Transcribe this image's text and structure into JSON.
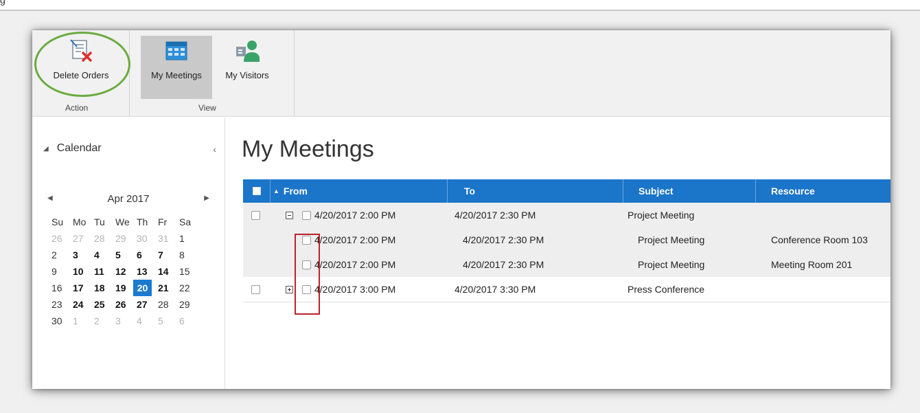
{
  "top_clip": "g",
  "ribbon": {
    "groups": [
      {
        "label": "Action"
      },
      {
        "label": "View"
      }
    ],
    "buttons": [
      {
        "label": "Delete Orders",
        "icon": "delete-orders-icon"
      },
      {
        "label": "My Meetings",
        "icon": "calendar-grid-icon"
      },
      {
        "label": "My Visitors",
        "icon": "visitors-icon"
      }
    ]
  },
  "calendar": {
    "header": "Calendar",
    "collapse": "‹",
    "month_title": "Apr 2017",
    "prev": "◀",
    "next": "▶",
    "dow": [
      "Su",
      "Mo",
      "Tu",
      "We",
      "Th",
      "Fr",
      "Sa"
    ],
    "weeks": [
      [
        {
          "d": "26",
          "s": "muted"
        },
        {
          "d": "27",
          "s": "muted"
        },
        {
          "d": "28",
          "s": "muted"
        },
        {
          "d": "29",
          "s": "muted"
        },
        {
          "d": "30",
          "s": "muted"
        },
        {
          "d": "31",
          "s": "muted"
        },
        {
          "d": "1",
          "s": ""
        }
      ],
      [
        {
          "d": "2",
          "s": ""
        },
        {
          "d": "3",
          "s": "bold"
        },
        {
          "d": "4",
          "s": "bold"
        },
        {
          "d": "5",
          "s": "bold"
        },
        {
          "d": "6",
          "s": "bold"
        },
        {
          "d": "7",
          "s": "bold"
        },
        {
          "d": "8",
          "s": ""
        }
      ],
      [
        {
          "d": "9",
          "s": ""
        },
        {
          "d": "10",
          "s": "bold"
        },
        {
          "d": "11",
          "s": "bold"
        },
        {
          "d": "12",
          "s": "bold"
        },
        {
          "d": "13",
          "s": "bold"
        },
        {
          "d": "14",
          "s": "bold"
        },
        {
          "d": "15",
          "s": ""
        }
      ],
      [
        {
          "d": "16",
          "s": ""
        },
        {
          "d": "17",
          "s": "bold"
        },
        {
          "d": "18",
          "s": "bold"
        },
        {
          "d": "19",
          "s": "bold"
        },
        {
          "d": "20",
          "s": "sel"
        },
        {
          "d": "21",
          "s": "bold"
        },
        {
          "d": "22",
          "s": ""
        }
      ],
      [
        {
          "d": "23",
          "s": ""
        },
        {
          "d": "24",
          "s": "bold"
        },
        {
          "d": "25",
          "s": "bold"
        },
        {
          "d": "26",
          "s": "bold"
        },
        {
          "d": "27",
          "s": "bold"
        },
        {
          "d": "28",
          "s": ""
        },
        {
          "d": "29",
          "s": ""
        }
      ],
      [
        {
          "d": "30",
          "s": ""
        },
        {
          "d": "1",
          "s": "muted"
        },
        {
          "d": "2",
          "s": "muted"
        },
        {
          "d": "3",
          "s": "muted"
        },
        {
          "d": "4",
          "s": "muted"
        },
        {
          "d": "5",
          "s": "muted"
        },
        {
          "d": "6",
          "s": "muted"
        }
      ]
    ]
  },
  "main": {
    "title": "My Meetings",
    "columns": [
      "From",
      "To",
      "Subject",
      "Resource"
    ],
    "sort_indicator": "▲",
    "rows": [
      {
        "from": "4/20/2017 2:00 PM",
        "to": "4/20/2017 2:30 PM",
        "subject": "Project Meeting",
        "resource": ""
      },
      {
        "from": "4/20/2017 2:00 PM",
        "to": "4/20/2017 2:30 PM",
        "subject": "Project Meeting",
        "resource": "Conference Room 103"
      },
      {
        "from": "4/20/2017 2:00 PM",
        "to": "4/20/2017 2:30 PM",
        "subject": "Project Meeting",
        "resource": "Meeting Room 201"
      },
      {
        "from": "4/20/2017 3:00 PM",
        "to": "4/20/2017 3:30 PM",
        "subject": "Press Conference",
        "resource": ""
      }
    ]
  },
  "colors": {
    "accent": "#1b75c9",
    "selected_day": "#1a7ad1",
    "highlight_ellipse": "#6aab3f",
    "highlight_box": "#c0202a"
  }
}
